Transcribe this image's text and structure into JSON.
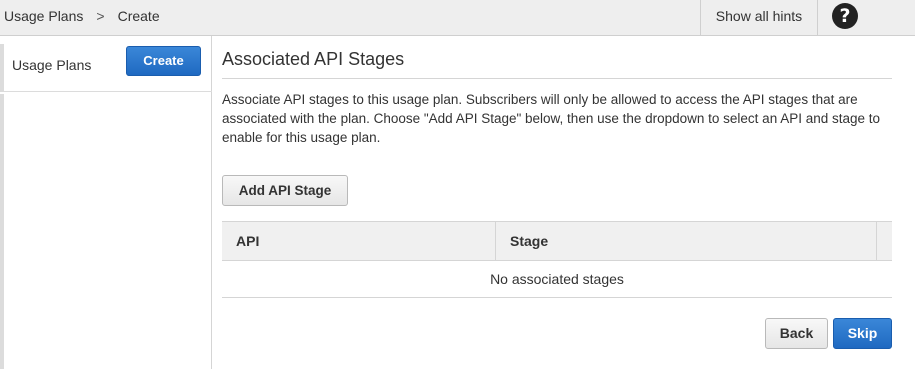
{
  "breadcrumb": {
    "items": [
      "Usage Plans",
      "Create"
    ],
    "separator": ">"
  },
  "topbar": {
    "hints_label": "Show all hints",
    "help_icon": "question-circle-icon",
    "help_glyph": "?"
  },
  "sidebar": {
    "title": "Usage Plans",
    "create_label": "Create"
  },
  "panel": {
    "title": "Associated API Stages",
    "description": "Associate API stages to this usage plan. Subscribers will only be allowed to access the API stages that are associated with the plan. Choose \"Add API Stage\" below, then use the dropdown to select an API and stage to enable for this usage plan.",
    "add_stage_label": "Add API Stage"
  },
  "table": {
    "columns": [
      "API",
      "Stage"
    ],
    "empty_message": "No associated stages"
  },
  "footer": {
    "back_label": "Back",
    "skip_label": "Skip"
  },
  "colors": {
    "primary_button": "#1f69c1",
    "topbar_bg": "#eeeeee",
    "table_header_bg": "#f0f0f0"
  }
}
